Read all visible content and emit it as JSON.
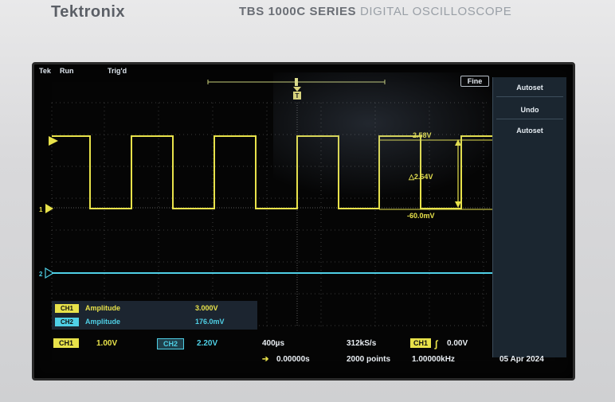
{
  "device": {
    "brand": "Tektronix",
    "series": "TBS 1000C SERIES",
    "series_sub": "DIGITAL OSCILLOSCOPE"
  },
  "status": {
    "logo": "Tek",
    "run_state": "Run",
    "trigger_state": "Trig'd",
    "fine_button": "Fine"
  },
  "menu": {
    "items": [
      "Autoset",
      "Undo",
      "Autoset"
    ]
  },
  "markers": {
    "ch1": "1",
    "ch2": "2",
    "trigger": "T"
  },
  "cursors": {
    "upper": "2.58V",
    "delta": "△2.64V",
    "lower": "-60.0mV"
  },
  "measurements": [
    {
      "channel": "CH1",
      "name": "Amplitude",
      "value": "3.000V",
      "color": "#e8e24a"
    },
    {
      "channel": "CH2",
      "name": "Amplitude",
      "value": "176.0mV",
      "color": "#4fd0e6"
    }
  ],
  "bottom": {
    "ch1_label": "CH1",
    "ch1_scale": "1.00V",
    "ch2_label": "CH2",
    "ch2_scale": "2.20V",
    "timebase": "400µs",
    "delay_arrow": "➔",
    "delay": "0.00000s",
    "sample_rate": "312kS/s",
    "record_length": "2000 points",
    "trigger_source": "CH1",
    "trigger_slope": "∫",
    "trigger_level": "0.00V",
    "trigger_freq": "1.00000kHz",
    "date": "05 Apr 2024"
  },
  "colors": {
    "ch1": "#e8e24a",
    "ch2": "#4fd0e6",
    "grid": "#4a4a4a"
  }
}
